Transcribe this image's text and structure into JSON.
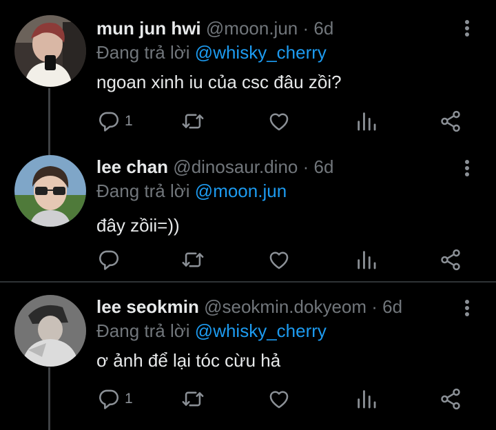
{
  "tweets": [
    {
      "name": "mun jun hwi",
      "handle": "@moon.jun",
      "sep": "·",
      "time": "6d",
      "reply_prefix": "Đang trả lời",
      "reply_to": "@whisky_cherry",
      "text": "ngoan xinh iu của csc đâu zồi?",
      "reply_count": "1"
    },
    {
      "name": "lee chan",
      "handle": "@dinosaur.dino",
      "sep": "·",
      "time": "6d",
      "reply_prefix": "Đang trả lời",
      "reply_to": "@moon.jun",
      "text": "đây zồii=))",
      "reply_count": ""
    },
    {
      "name": "lee seokmin",
      "handle": "@seokmin.dokyeom",
      "sep": "·",
      "time": "6d",
      "reply_prefix": "Đang trả lời",
      "reply_to": "@whisky_cherry",
      "text": "ơ ảnh để lại tóc cừu hả",
      "reply_count": "1"
    }
  ],
  "colors": {
    "background": "#000000",
    "text": "#e7e9ea",
    "secondary": "#71767b",
    "mention": "#1d9bf0",
    "divider": "#2f3336"
  },
  "icons": [
    "more-vertical-icon",
    "reply-icon",
    "retweet-icon",
    "like-icon",
    "stats-icon",
    "share-icon"
  ]
}
